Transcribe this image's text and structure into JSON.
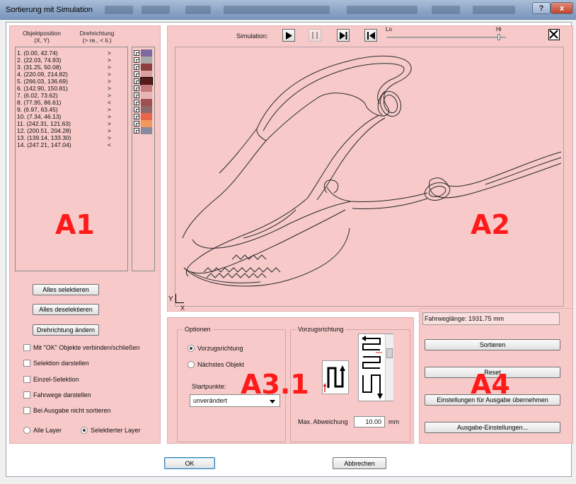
{
  "window": {
    "title": "Sortierung mit Simulation",
    "help_label": "?",
    "close_label": "x"
  },
  "a1": {
    "header_position": "Objektposition",
    "header_position_sub": "(X, Y)",
    "header_direction": "Drehrichtung",
    "header_direction_sub": "(> re., < li.)",
    "items": [
      {
        "label": "1. (0.00, 42.74)",
        "dir": ">"
      },
      {
        "label": "2. (22.03, 74.93)",
        "dir": ">"
      },
      {
        "label": "3. (31.25, 50.08)",
        "dir": ">"
      },
      {
        "label": "4. (220.09, 214.82)",
        "dir": ">"
      },
      {
        "label": "5. (266.03, 136.69)",
        "dir": ">"
      },
      {
        "label": "6. (142.90, 150.81)",
        "dir": ">"
      },
      {
        "label": "7. (6.02, 73.62)",
        "dir": ">"
      },
      {
        "label": "8. (77.95, 86.61)",
        "dir": "<"
      },
      {
        "label": "9. (6.97, 63.45)",
        "dir": ">"
      },
      {
        "label": "10. (7.34, 46.13)",
        "dir": ">"
      },
      {
        "label": "11. (242.31, 121.63)",
        "dir": ">"
      },
      {
        "label": "12. (200.51, 204.28)",
        "dir": ">"
      },
      {
        "label": "13. (139.14, 133.30)",
        "dir": ">"
      },
      {
        "label": "14. (247.21, 147.04)",
        "dir": "<"
      }
    ],
    "swatch_colors": [
      "#7b6aa0",
      "#a8a8a8",
      "#8c3f3f",
      "#d9a0a0",
      "#5a1a1a",
      "#c47a7a",
      "#e6b4b4",
      "#9c5050",
      "#8c6a6a",
      "#e8664a",
      "#f29a5a",
      "#8a8a9e"
    ],
    "selected_swatch": 4,
    "big_label": "A1",
    "btn_select_all": "Alles selektieren",
    "btn_deselect_all": "Alles deselektieren",
    "btn_change_direction": "Drehrichtung ändern",
    "checkboxes": [
      "Mit \"OK\" Objekte verbinden/schließen",
      "Selektion darstellen",
      "Einzel-Selektion",
      "Fahrwege darstellen",
      "Bei Ausgabe nicht sortieren"
    ],
    "radio_all_layers": "Alle Layer",
    "radio_selected_layer": "Selektierter Layer"
  },
  "a2": {
    "sim_label": "Simulation:",
    "lo_label": "Lo",
    "hi_label": "Hi",
    "big_label": "A2",
    "axis_y": "Y",
    "axis_x": "X"
  },
  "a3": {
    "options_legend": "Optionen",
    "radio_pref_dir": "Vorzugsrichtung",
    "radio_next_obj": "Nächstes Objekt",
    "start_label": "Startpunkte:",
    "start_value": "unverändert",
    "pref_legend": "Vorzugsrichtung",
    "max_dev_label": "Max. Abweichung",
    "max_dev_value": "10.00",
    "unit": "mm",
    "big_label": "A3.1"
  },
  "a4": {
    "travel_length": "Fahrweglänge: 1931.75 mm",
    "btn_sort": "Sortieren",
    "btn_reset": "Reset",
    "btn_apply": "Einstellungen für Ausgabe übernehmen",
    "btn_output": "Ausgabe-Einstellungen...",
    "big_label": "A4"
  },
  "footer": {
    "ok": "OK",
    "cancel": "Abbrechen"
  }
}
